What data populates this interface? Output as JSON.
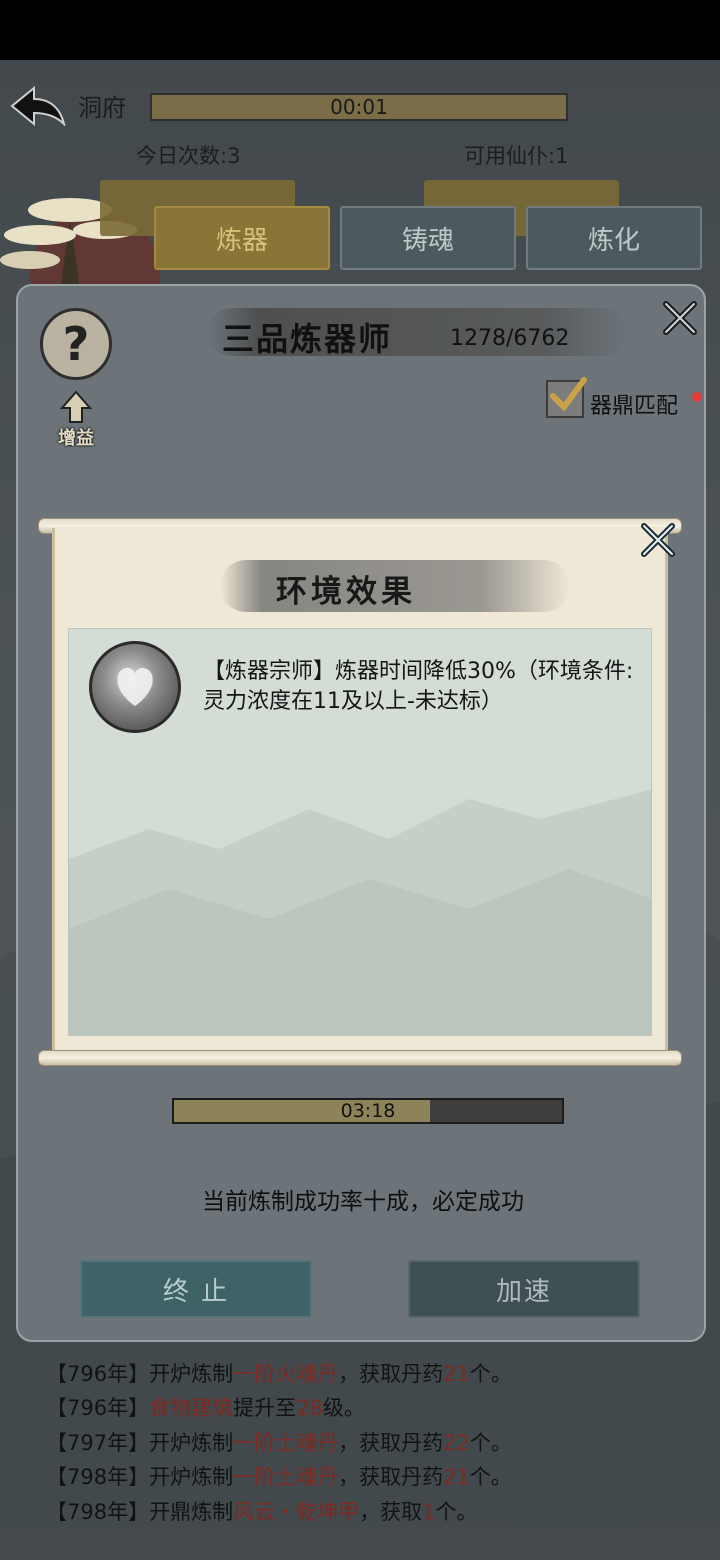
{
  "header": {
    "location": "洞府",
    "timer": "00:01",
    "today_count": "今日次数:3",
    "available_servants": "可用仙仆:1"
  },
  "tabs": [
    {
      "label": "炼器",
      "active": true
    },
    {
      "label": "铸魂",
      "active": false
    },
    {
      "label": "炼化",
      "active": false
    }
  ],
  "panel": {
    "title": "三品炼器师",
    "exp": "1278/6762",
    "help_label": "?",
    "buff_label": "增益",
    "match_label": "器鼎匹配",
    "match_checked": true,
    "progress_text": "03:18",
    "progress_fraction": 0.66,
    "success_text": "当前炼制成功率十成，必定成功",
    "stop_label": "终 止",
    "speed_label": "加速"
  },
  "dialog": {
    "title": "环境效果",
    "effect_text": "【炼器宗师】炼器时间降低30%（环境条件:灵力浓度在11及以上-未达标）"
  },
  "log": [
    {
      "year": "【796年】",
      "parts": [
        [
          "开炉炼制",
          ""
        ],
        [
          "一阶火魂丹",
          "hl"
        ],
        [
          "，获取丹药",
          ""
        ],
        [
          "21",
          "num"
        ],
        [
          "个。",
          ""
        ]
      ]
    },
    {
      "year": "【796年】",
      "parts": [
        [
          "食物建筑",
          "hl"
        ],
        [
          "提升至",
          ""
        ],
        [
          "28",
          "num"
        ],
        [
          "级。",
          ""
        ]
      ]
    },
    {
      "year": "【797年】",
      "parts": [
        [
          "开炉炼制",
          ""
        ],
        [
          "一阶土魂丹",
          "hl"
        ],
        [
          "，获取丹药",
          ""
        ],
        [
          "22",
          "num"
        ],
        [
          "个。",
          ""
        ]
      ]
    },
    {
      "year": "【798年】",
      "parts": [
        [
          "开炉炼制",
          ""
        ],
        [
          "一阶土魂丹",
          "hl"
        ],
        [
          "，获取丹药",
          ""
        ],
        [
          "21",
          "num"
        ],
        [
          "个。",
          ""
        ]
      ]
    },
    {
      "year": "【798年】",
      "parts": [
        [
          "开鼎炼制",
          ""
        ],
        [
          "风云・乾坤甲",
          "hl"
        ],
        [
          "，获取",
          ""
        ],
        [
          "1",
          "num"
        ],
        [
          "个。",
          ""
        ]
      ]
    }
  ],
  "colors": {
    "accent_gold": "#8a7538",
    "log_highlight": "#7e2a22",
    "scroll_paper": "#efe8d6",
    "effect_bg": "#d3ddd5"
  }
}
